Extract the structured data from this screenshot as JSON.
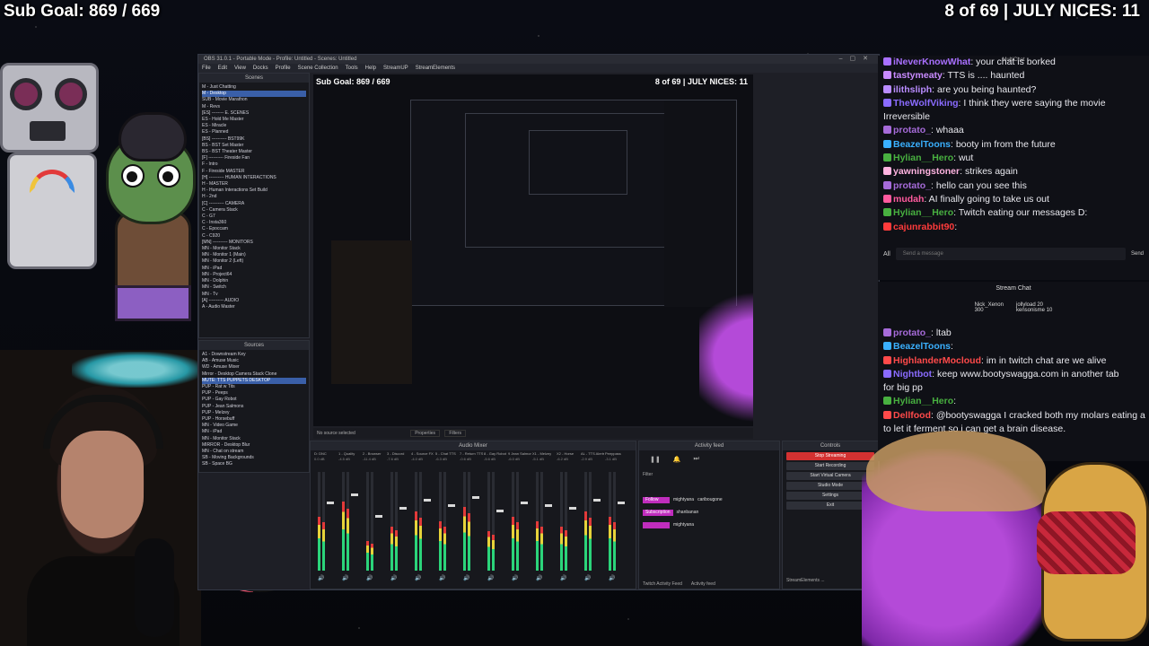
{
  "overlay": {
    "sub_goal": "Sub Goal: 869 / 669",
    "nices": "8 of 69 | JULY NICES: 11"
  },
  "obs": {
    "window_title": "OBS 31.0.1 - Portable Mode - Profile: Untitled - Scenes: Untitled",
    "menu": [
      "File",
      "Edit",
      "View",
      "Docks",
      "Profile",
      "Scene Collection",
      "Tools",
      "Help",
      "StreamUP",
      "StreamElements"
    ],
    "scenes_header": "Scenes",
    "scenes": [
      "M - Just Chatting",
      "M - Desktop",
      "SUB - Movie Marathon",
      "M - Revs",
      "[ES] -------- E. SCENES",
      "ES - Hold Me Master",
      "ES - Miracle",
      "ES - Planned",
      "[BS] ---------- BST99K",
      "BS - BST Set Master",
      "BS - BST Theater Master",
      "[F] ---------- Fireside Fan",
      "F - Intro",
      "F - Fireside MASTER",
      "[H] ---------- HUMAN INTERACTIONS",
      "H - MASTER",
      "H - Human Interactions Set Build",
      "H - 2nd",
      "[C] ---------- CAMERA",
      "C - Camera Stack",
      "C - G7",
      "C - Insta360",
      "C - Epoccam",
      "C - C920",
      "[MN] ---------- MONITORS",
      "MN - Monitor Stack",
      "MN - Monitor 1 (Main)",
      "MN - Monitor 2 (Left)",
      "MN - iPad",
      "MN - Project64",
      "MN - Dolphin",
      "MN - Switch",
      "MN - Tv",
      "[A] ---------- AUDIO",
      "A - Audio Master"
    ],
    "sources_header": "Sources",
    "sources": [
      "A1 - Downstream Key",
      "AB - Amuse Music",
      "WD - Amuse Mixer",
      "Mirror - Desktop Camera Stack Clone",
      "MUTE: TTS PUPPETS DESKTOP",
      "PUP - Rat w Tits",
      "PUP - Peeps",
      "PUP - Gay Robot",
      "PUP - Jean Salmons",
      "PUP - Melzey",
      "PUP - Horsebuff",
      "MN - Video Game",
      "MN - iPad",
      "MN - Monitor Stack",
      "MIRROR - Desktop Blur",
      "MN - Chat on stream",
      "SB - Moving Backgrounds",
      "SB - Space BG"
    ],
    "preview_title": "Sub Goal: 869 / 669",
    "preview_nices": "8 of 69 | JULY NICES: 11",
    "no_source": "No source selected",
    "properties": "Properties",
    "filters": "Filters",
    "mixer_title": "Audio Mixer",
    "mixer_channels": [
      "D: DNC",
      "1 - Quality",
      "2 - Browser",
      "3 - Discord",
      "4 - Source FX",
      "5 - Chat TTS",
      "7 - Return TTS",
      "8 - Gay Robot",
      "9 Jean Salmons",
      "X1 - Melzey",
      "X2 - Horse",
      "AL - TTS Alerts",
      "Peeppass"
    ],
    "mixer_values": [
      "0.0 dB",
      "-4.5 dB",
      "-11.4 dB",
      "-7.6 dB",
      "-4.0 dB",
      "-6.3 dB",
      "-0.6 dB",
      "-5.6 dB",
      "-6.0 dB",
      "-5.1 dB",
      "-6.2 dB",
      "-2.9 dB",
      "-3.1 dB"
    ],
    "activity_title": "Activity feed",
    "activity_filter": "Filter",
    "activity_items": [
      {
        "type": "Follow",
        "user": "mightyana",
        "text": "caribougone"
      },
      {
        "type": "Subscription",
        "user": "shanbanan",
        "text": ""
      },
      {
        "type": "",
        "user": "mightyana",
        "text": ""
      }
    ],
    "activity_tabs": [
      "Twitch Activity Feed",
      "Activity feed",
      "StreamElements Live"
    ],
    "controls_title": "Controls",
    "controls": [
      "Stop Streaming",
      "Start Recording",
      "Start Virtual Camera",
      "Studio Mode",
      "Settings",
      "Exit"
    ],
    "streamelements": "StreamElements ..."
  },
  "multichat": {
    "title": "MultiChat",
    "messages": [
      {
        "user": "iNeverKnowWhat",
        "color": "#a970ff",
        "text": ": your chat is borked"
      },
      {
        "user": "tastymeaty",
        "color": "#c98bff",
        "text": ": TTS is .... haunted"
      },
      {
        "user": "ilithsliph",
        "color": "#b98cff",
        "text": ": are you being haunted?"
      },
      {
        "user": "TheWolfViking",
        "color": "#8a6bff",
        "text": ": I think they were saying the movie"
      },
      {
        "user": "",
        "color": "#e8e8ee",
        "text": "Irreversible"
      },
      {
        "user": "protato_",
        "color": "#a66bd9",
        "text": ": whaaa"
      },
      {
        "user": "BeazelToons",
        "color": "#3ab0ff",
        "text": ": booty im from the future"
      },
      {
        "user": "Hylian__Hero",
        "color": "#48b040",
        "text": ": wut"
      },
      {
        "user": "yawningstoner",
        "color": "#ffb3e0",
        "text": ": strikes again"
      },
      {
        "user": "protato_",
        "color": "#a66bd9",
        "text": ": hello can you see this"
      },
      {
        "user": "mudah",
        "color": "#ff5a9e",
        "text": ": AI finally going to take us out"
      },
      {
        "user": "Hylian__Hero",
        "color": "#48b040",
        "text": ": Twitch eating our messages D:"
      },
      {
        "user": "cajunrabbit90",
        "color": "#ff3b3b",
        "text": ":"
      }
    ],
    "filter_all": "All",
    "input_placeholder": "Send a message",
    "send": "Send"
  },
  "stream_chat": {
    "title": "Stream Chat",
    "leaderboard": [
      {
        "name": "Nick_Xenon",
        "value": "300"
      },
      {
        "name": "jollyload",
        "value": "20"
      },
      {
        "name": "kensonisme",
        "value": "10"
      }
    ],
    "messages": [
      {
        "user": "protato_",
        "color": "#a66bd9",
        "text": ": ltab"
      },
      {
        "user": "BeazelToons",
        "color": "#3ab0ff",
        "text": ":"
      },
      {
        "user": "HighlanderMocloud",
        "color": "#ff4a4a",
        "text": ": im in twitch chat are we alive"
      },
      {
        "user": "Nightbot",
        "color": "#8a6bff",
        "text": ": keep www.bootyswagga.com in another tab"
      },
      {
        "user": "",
        "color": "#e8e8ee",
        "text": "for big pp"
      },
      {
        "user": "Hylian__Hero",
        "color": "#48b040",
        "text": ":"
      },
      {
        "user": "Dellfood",
        "color": "#ff4a4a",
        "text": ": @bootyswagga I cracked both my molars eating a"
      },
      {
        "user": "",
        "color": "#e8e8ee",
        "text": "                 to let it ferment so i can get a brain disease."
      }
    ]
  },
  "colors": {
    "obs_bg": "#1e1f26",
    "stop_streaming": "#d33131",
    "selection": "#3a5fa8",
    "horse": "#b44ad8"
  }
}
